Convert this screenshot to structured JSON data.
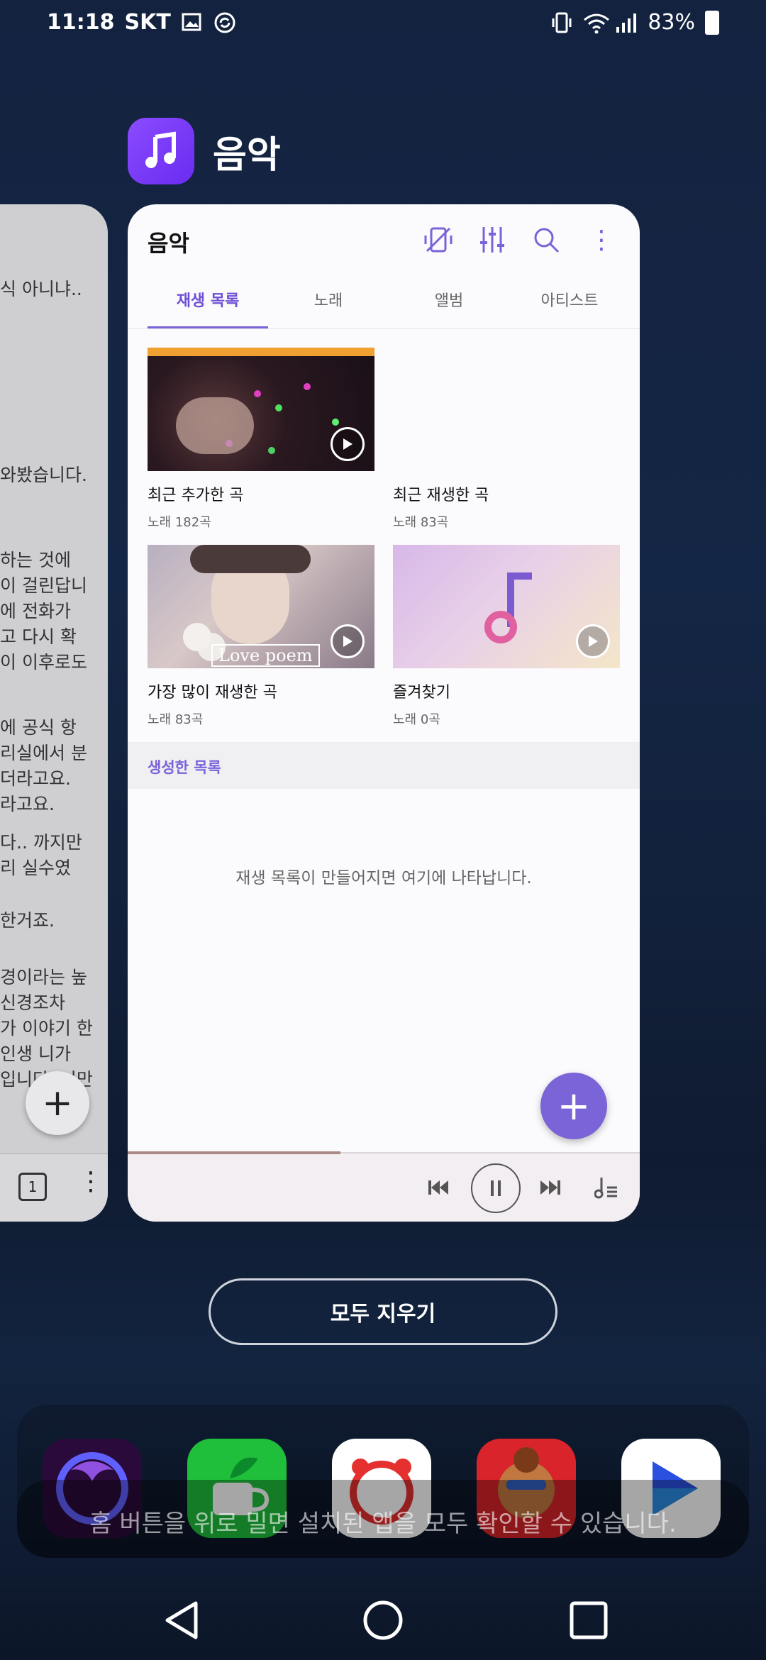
{
  "status_bar": {
    "time": "11:18",
    "carrier": "SKT",
    "battery": "83%",
    "icons": [
      "gallery-icon",
      "sync-icon",
      "vibrate-icon",
      "wifi-icon",
      "signal-icon",
      "battery-icon"
    ]
  },
  "app_label": {
    "name": "음악",
    "icon": "music-note-icon",
    "color": "#7a3cf6"
  },
  "left_card": {
    "lines": [
      "식 아니냐..",
      "와봤습니다.",
      "하는 것에",
      "이 걸린답니",
      "에 전화가",
      "고 다시 확",
      "이 이후로도",
      "에 공식 항",
      "리실에서 분",
      "더라고요.",
      "라고요.",
      "다.. 까지만",
      "리 실수였",
      "한거죠.",
      "경이라는 높",
      "신경조차",
      "가 이야기 한",
      "인생 니가",
      "입니다. 니만"
    ],
    "tab_count": "1"
  },
  "music_card": {
    "title": "음악",
    "tabs": [
      "재생 목록",
      "노래",
      "앨범",
      "아티스트"
    ],
    "active_tab": 0,
    "accent": "#7b63d8",
    "playlists": [
      {
        "title": "최근 추가한 곡",
        "subtitle": "노래 182곡"
      },
      {
        "title": "최근 재생한 곡",
        "subtitle": "노래 83곡"
      },
      {
        "title": "가장 많이 재생한 곡",
        "subtitle": "노래 83곡",
        "cover_text": "Love poem"
      },
      {
        "title": "즐겨찾기",
        "subtitle": "노래 0곡"
      }
    ],
    "section_title": "생성한 목록",
    "empty_message": "재생 목록이 만들어지면 여기에 나타납니다."
  },
  "clear_all": "모두 지우기",
  "dock": {
    "apps": [
      "firefox-icon",
      "coffee-app-icon",
      "alarm-clock-icon",
      "cookie-run-icon",
      "play-icon"
    ],
    "hint": "홈 버튼을 위로 밀면 설치된 앱을 모두 확인할 수 있습니다."
  }
}
